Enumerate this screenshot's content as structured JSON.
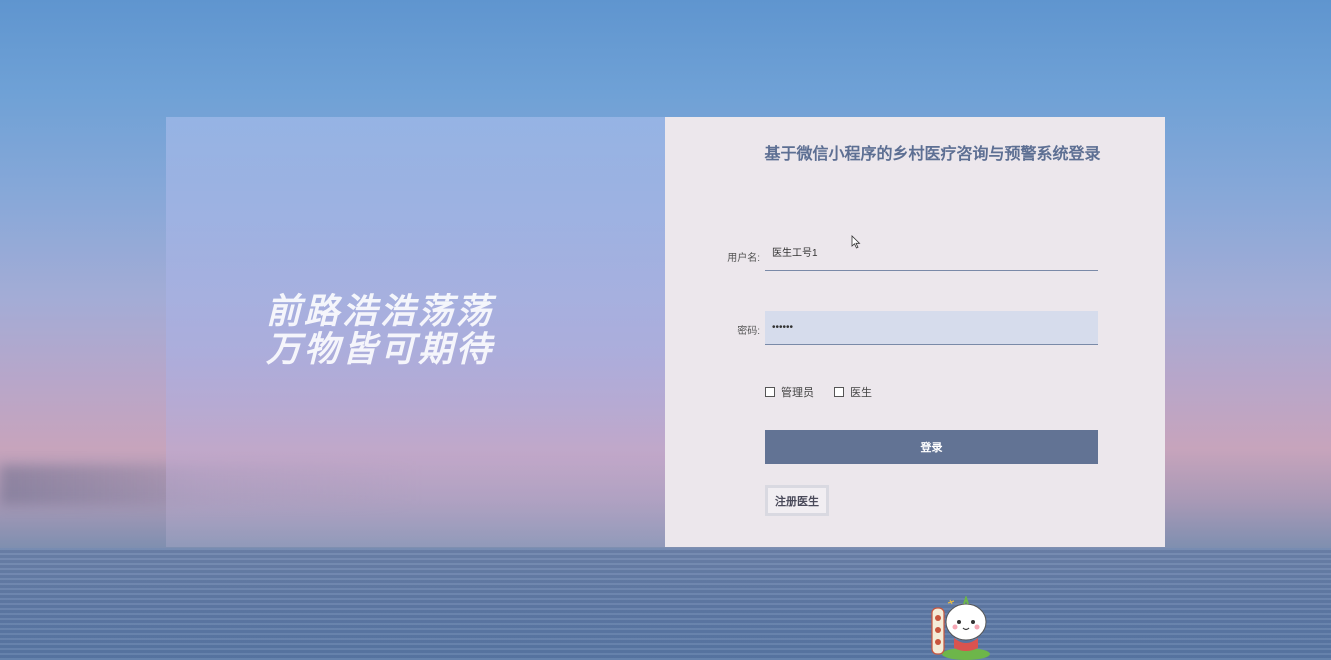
{
  "page": {
    "slogan_line1": "前路浩浩荡荡",
    "slogan_line2": "万物皆可期待"
  },
  "login": {
    "title": "基于微信小程序的乡村医疗咨询与预警系统登录",
    "username_label": "用户名:",
    "username_value": "医生工号1",
    "password_label": "密码:",
    "password_value": "••••••",
    "role_admin": "管理员",
    "role_doctor": "医生",
    "login_button": "登录",
    "register_button": "注册医生"
  },
  "icons": {
    "cursor": "mouse-pointer-icon",
    "mascot": "cartoon-mascot-icon"
  }
}
